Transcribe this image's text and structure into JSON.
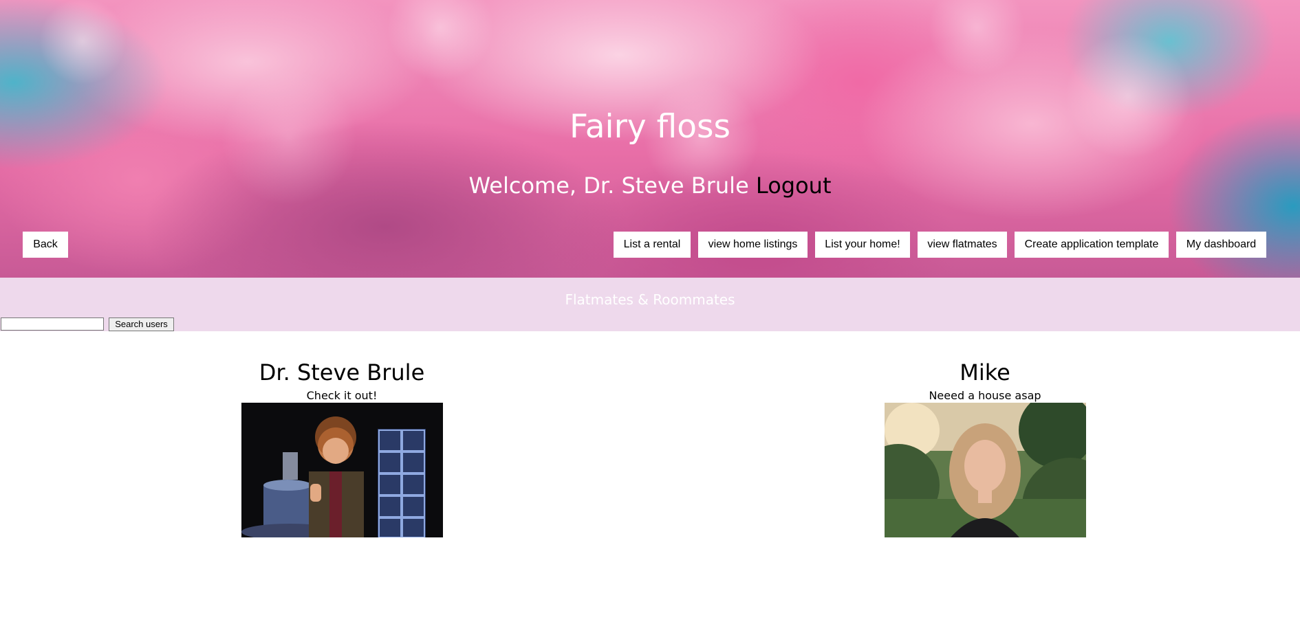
{
  "header": {
    "site_title": "Fairy floss",
    "welcome_text": "Welcome, Dr. Steve Brule",
    "logout_label": "Logout"
  },
  "nav": {
    "back_label": "Back",
    "list_rental_label": "List a rental",
    "view_home_listings_label": "view home listings",
    "list_your_home_label": "List your home!",
    "view_flatmates_label": "view flatmates",
    "create_template_label": "Create application template",
    "my_dashboard_label": "My dashboard"
  },
  "section": {
    "title": "Flatmates & Roommates",
    "search_value": "",
    "search_button_label": "Search users"
  },
  "users": [
    {
      "name": "Dr. Steve Brule",
      "status": "Check it out!"
    },
    {
      "name": "Mike",
      "status": "Neeed a house asap"
    }
  ],
  "colors": {
    "section_band": "#eed9ec",
    "hero_pink": "#e86ea7",
    "hero_teal": "#2a9bbf"
  }
}
